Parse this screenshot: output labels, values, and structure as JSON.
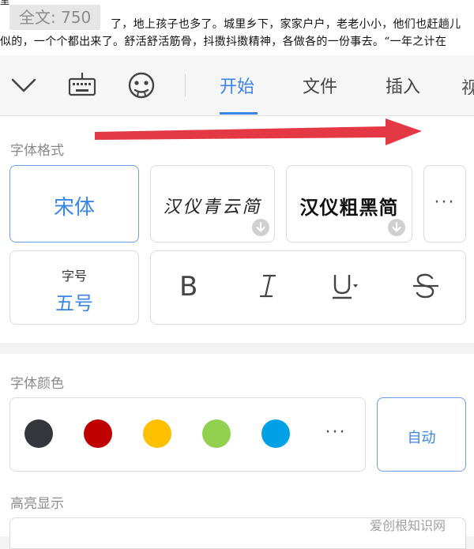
{
  "document": {
    "line0": "里",
    "line1": "了，地上孩子也多了。城里乡下，家家户户，老老小小，他们也赶趟儿",
    "line2": "似的，一个个都出来了。舒活舒活筋骨，抖擞抖擞精神，各做各的一份事去。“一年之计在",
    "word_count": "全文: 750"
  },
  "toolbar": {
    "icons": [
      "chevron-down-icon",
      "keyboard-icon",
      "emoji-icon"
    ],
    "tabs": [
      {
        "label": "开始",
        "active": true
      },
      {
        "label": "文件",
        "active": false
      },
      {
        "label": "插入",
        "active": false
      }
    ],
    "overflow_tab": "视"
  },
  "font_format": {
    "section_label": "字体格式",
    "fonts": [
      {
        "label": "宋体",
        "selected": true,
        "downloadable": false
      },
      {
        "label": "汉仪青云简",
        "selected": false,
        "downloadable": true
      },
      {
        "label": "汉仪粗黑简",
        "selected": false,
        "downloadable": true
      }
    ],
    "more_label": "···",
    "size": {
      "caption": "字号",
      "value": "五号"
    },
    "style_buttons": [
      "bold-icon",
      "italic-icon",
      "underline-icon",
      "strikethrough-icon"
    ]
  },
  "font_color": {
    "section_label": "字体颜色",
    "swatches": [
      "#35363b",
      "#c00000",
      "#ffc000",
      "#92d050",
      "#00a0e6"
    ],
    "more_label": "···",
    "auto_label": "自动"
  },
  "highlight": {
    "section_label": "高亮显示"
  },
  "accent_color": "#3a86e8",
  "annotation_arrow_color": "#e53845",
  "watermark": "爱创根知识网"
}
